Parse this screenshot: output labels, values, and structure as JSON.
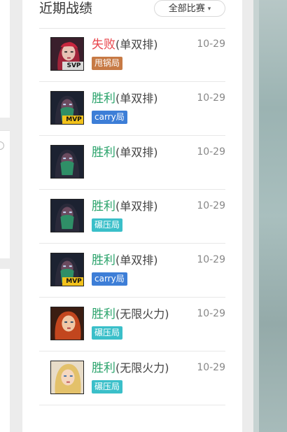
{
  "header": {
    "title": "近期战绩",
    "filter_label": "全部比赛"
  },
  "matches": [
    {
      "result": "失败",
      "result_type": "loss",
      "mode": "(单双排)",
      "date": "10-29",
      "badge": "甩锅局",
      "badge_color": "#c77a45",
      "rank_tag": "SVP",
      "champion_icon": "red-hair-champion"
    },
    {
      "result": "胜利",
      "result_type": "win",
      "mode": "(单双排)",
      "date": "10-29",
      "badge": "carry局",
      "badge_color": "#3d7ed7",
      "rank_tag": "MVP",
      "champion_icon": "masked-assassin-champion"
    },
    {
      "result": "胜利",
      "result_type": "win",
      "mode": "(单双排)",
      "date": "10-29",
      "badge": "",
      "badge_color": "",
      "rank_tag": "",
      "champion_icon": "masked-assassin-champion"
    },
    {
      "result": "胜利",
      "result_type": "win",
      "mode": "(单双排)",
      "date": "10-29",
      "badge": "碾压局",
      "badge_color": "#3abfc9",
      "rank_tag": "",
      "champion_icon": "masked-assassin-champion"
    },
    {
      "result": "胜利",
      "result_type": "win",
      "mode": "(单双排)",
      "date": "10-29",
      "badge": "carry局",
      "badge_color": "#3d7ed7",
      "rank_tag": "MVP",
      "champion_icon": "masked-assassin-champion"
    },
    {
      "result": "胜利",
      "result_type": "win",
      "mode": "(无限火力)",
      "date": "10-29",
      "badge": "碾压局",
      "badge_color": "#3abfc9",
      "rank_tag": "",
      "champion_icon": "red-hair-gunner-champion"
    },
    {
      "result": "胜利",
      "result_type": "win",
      "mode": "(无限火力)",
      "date": "10-29",
      "badge": "碾压局",
      "badge_color": "#3abfc9",
      "rank_tag": "",
      "champion_icon": "blonde-mage-champion"
    }
  ]
}
